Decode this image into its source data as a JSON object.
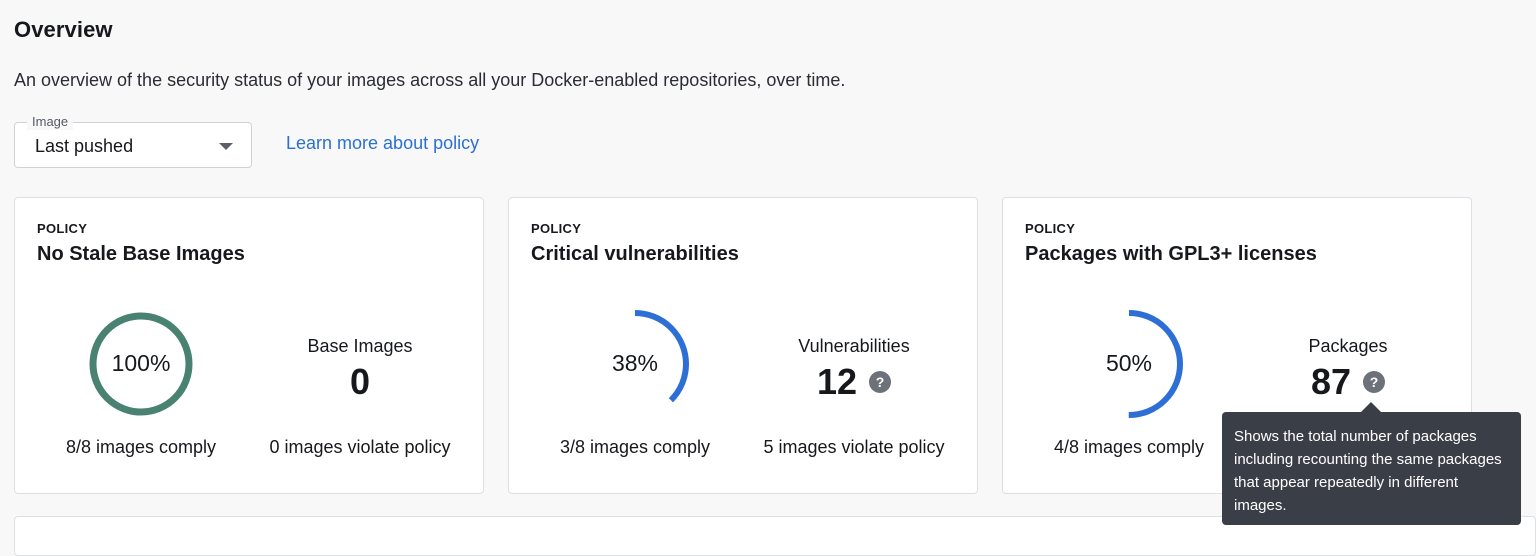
{
  "header": {
    "title": "Overview",
    "description": "An overview of the security status of your images across all your Docker-enabled repositories, over time."
  },
  "filter": {
    "label": "Image",
    "value": "Last pushed",
    "learn_more": "Learn more about policy"
  },
  "colors": {
    "compliant": "#4a8272",
    "progress": "#2e6fd6",
    "link": "#2a70d2",
    "tooltip_bg": "#3a3f47",
    "help_icon": "#6d7179"
  },
  "cards": [
    {
      "tag": "POLICY",
      "title": "No Stale Base Images",
      "percent_label": "100%",
      "fraction": 1.0,
      "comply": "8/8 images comply",
      "metric_label": "Base Images",
      "metric_value": "0",
      "has_help": false,
      "violate": "0 images violate policy"
    },
    {
      "tag": "POLICY",
      "title": "Critical vulnerabilities",
      "percent_label": "38%",
      "fraction": 0.375,
      "comply": "3/8 images comply",
      "metric_label": "Vulnerabilities",
      "metric_value": "12",
      "has_help": true,
      "help_glyph": "?",
      "violate": "5 images violate policy"
    },
    {
      "tag": "POLICY",
      "title": "Packages with GPL3+ licenses",
      "percent_label": "50%",
      "fraction": 0.5,
      "comply": "4/8 images comply",
      "metric_label": "Packages",
      "metric_value": "87",
      "has_help": true,
      "help_glyph": "?",
      "violate": ""
    }
  ],
  "tooltip": {
    "text": "Shows the total number of packages including recounting the same packages that appear repeatedly in different images."
  }
}
